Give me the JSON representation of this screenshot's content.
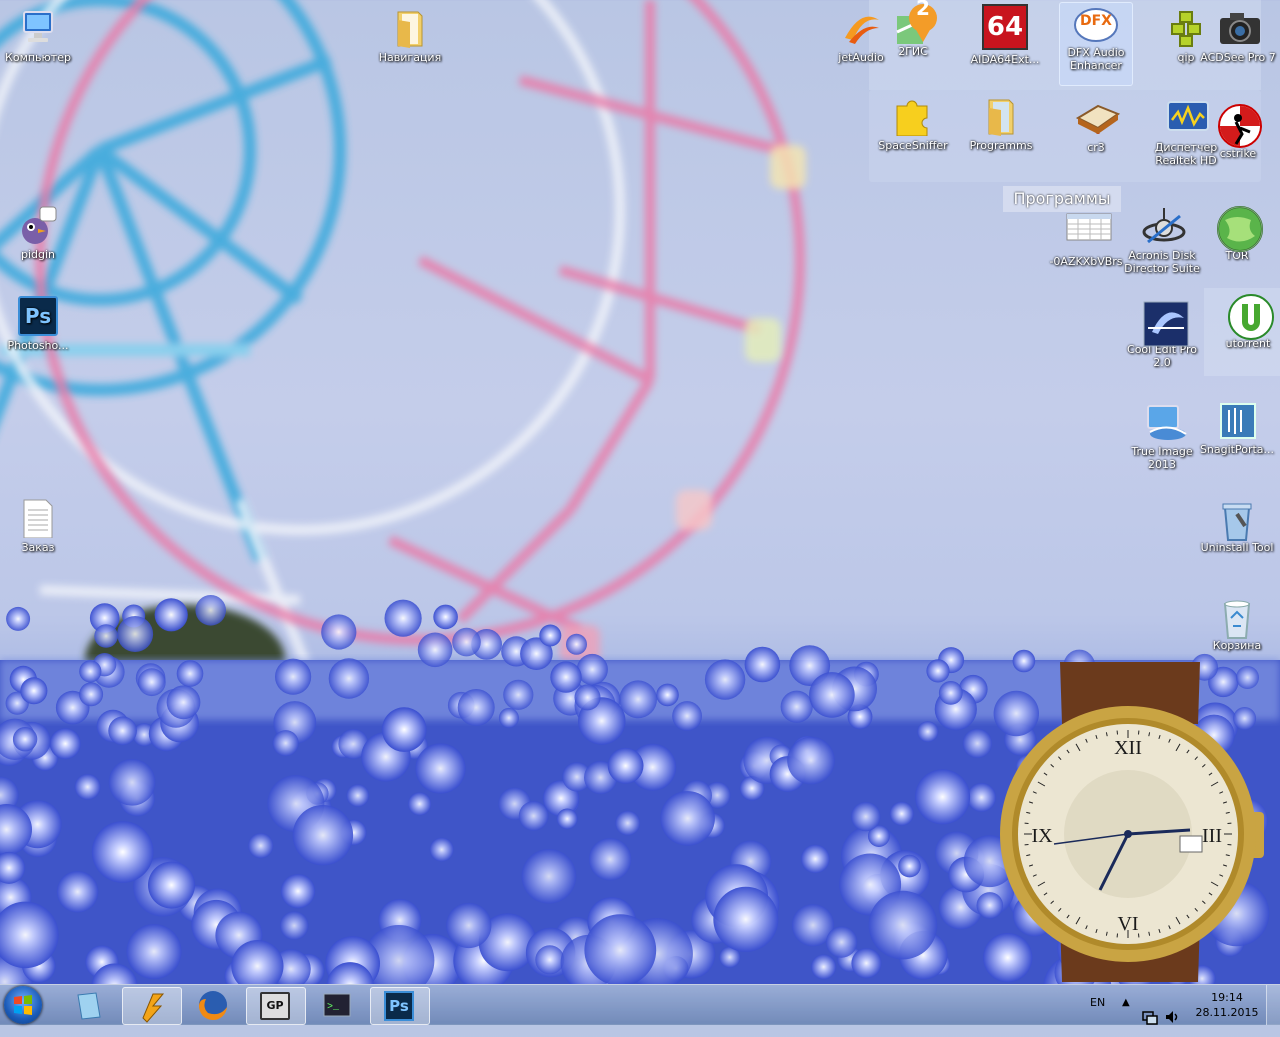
{
  "desktop_icons": {
    "computer": "Компьютер",
    "navigation": "Навигация",
    "pidgin": "pidgin",
    "photoshop": "Photosho...",
    "order": "Заказ",
    "jetaudio": "jetAudio",
    "twogis": "2ГИС",
    "aida": "AIDA64Ext...",
    "dfx": "DFX Audio Enhancer",
    "qip": "qip",
    "acdsee": "ACDSee Pro 7",
    "spacesniffer": "SpaceSniffer",
    "programms": "Programms",
    "cr3": "cr3",
    "realtek": "Диспетчер Realtek HD",
    "cstrike": "cstrike",
    "file_0az": "-0AZKXbVBrs",
    "acronis": "Acronis Disk Director Suite",
    "tor": "TOR",
    "cooledit": "Cool Edit Pro 2.0",
    "utorrent": "utorrent",
    "trueimage": "True Image 2013",
    "snagit": "SnagitPorta...",
    "uninstall": "Uninstall Tool",
    "recycle": "Корзина"
  },
  "badges": {
    "twogis_badge": "2",
    "aida_badge": "64",
    "dfx_badge": "DFX"
  },
  "fence": {
    "title": "Программы"
  },
  "taskbar": {
    "language": "EN",
    "time": "19:14",
    "date": "28.11.2015",
    "gp_label": "GP",
    "ps_label": "Ps"
  },
  "photoshop_icon_text": "Ps",
  "colors": {
    "sky": "#c4cdea",
    "flowers": "#3346b5",
    "ferris_blue": "#2fa4d8",
    "ferris_pink": "#e8709e"
  }
}
